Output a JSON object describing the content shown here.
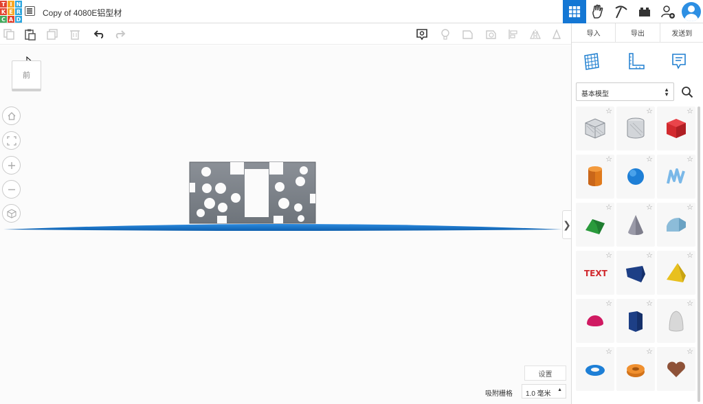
{
  "app": {
    "logo_letters": [
      "T",
      "I",
      "N",
      "K",
      "E",
      "R",
      "C",
      "A",
      "D"
    ],
    "logo_colors": [
      "#e2442f",
      "#f6a623",
      "#2da6de",
      "#e2442f",
      "#f6a623",
      "#2da6de",
      "#41ab5d",
      "#e2442f",
      "#2da6de"
    ],
    "design_title": "Copy of 4080E铝型材"
  },
  "header": {
    "buttons": [
      {
        "icon": "grid-view-icon",
        "active": true
      },
      {
        "icon": "tinker-hand-icon",
        "active": false
      },
      {
        "icon": "pickaxe-icon",
        "active": false
      },
      {
        "icon": "bricks-icon",
        "active": false
      },
      {
        "icon": "add-user-icon",
        "active": false
      },
      {
        "icon": "user-avatar-icon",
        "active": false
      }
    ],
    "accent": "#1477d4"
  },
  "toolbar": {
    "left_icons": [
      "copy-icon",
      "paste-icon",
      "duplicate-icon",
      "delete-icon",
      "undo-icon",
      "redo-icon"
    ],
    "right_icons": [
      "notes-icon",
      "light-bulb-icon",
      "solid-shape-icon",
      "hole-shape-icon",
      "align-icon",
      "mirror-icon",
      "cruise-icon"
    ]
  },
  "panel": {
    "tabs": [
      "导入",
      "导出",
      "发送到"
    ],
    "view_icons": [
      "workplane-icon",
      "ruler-icon",
      "notes-icon"
    ],
    "shape_library": "基本模型",
    "shapes": [
      {
        "name": "Box Hole",
        "icon": "box-hole-shape"
      },
      {
        "name": "Cylinder Hole",
        "icon": "cylinder-hole-shape"
      },
      {
        "name": "Box",
        "icon": "box-shape"
      },
      {
        "name": "Cylinder",
        "icon": "cylinder-shape"
      },
      {
        "name": "Sphere",
        "icon": "sphere-shape"
      },
      {
        "name": "Scribble",
        "icon": "scribble-shape"
      },
      {
        "name": "Roof",
        "icon": "roof-shape"
      },
      {
        "name": "Cone",
        "icon": "cone-shape"
      },
      {
        "name": "Round Roof",
        "icon": "round-roof-shape"
      },
      {
        "name": "Text",
        "icon": "text-shape"
      },
      {
        "name": "Wedge",
        "icon": "wedge-shape"
      },
      {
        "name": "Pyramid",
        "icon": "pyramid-shape"
      },
      {
        "name": "Half Sphere",
        "icon": "half-sphere-shape"
      },
      {
        "name": "Polygon",
        "icon": "polygon-shape"
      },
      {
        "name": "Paraboloid",
        "icon": "paraboloid-shape"
      },
      {
        "name": "Torus",
        "icon": "torus-shape"
      },
      {
        "name": "Tube",
        "icon": "tube-shape"
      },
      {
        "name": "Heart",
        "icon": "heart-shape"
      }
    ]
  },
  "workplane": {
    "view_cube_label": "前",
    "nav_buttons": [
      "home-view-icon",
      "fit-all-icon",
      "zoom-in-icon",
      "zoom-out-icon",
      "perspective-icon"
    ],
    "settings_label": "设置",
    "snap_label": "吸附栅格",
    "snap_value": "1.0 毫米",
    "model_color": "#7a8088",
    "plane_color": "#1c7ed0"
  }
}
